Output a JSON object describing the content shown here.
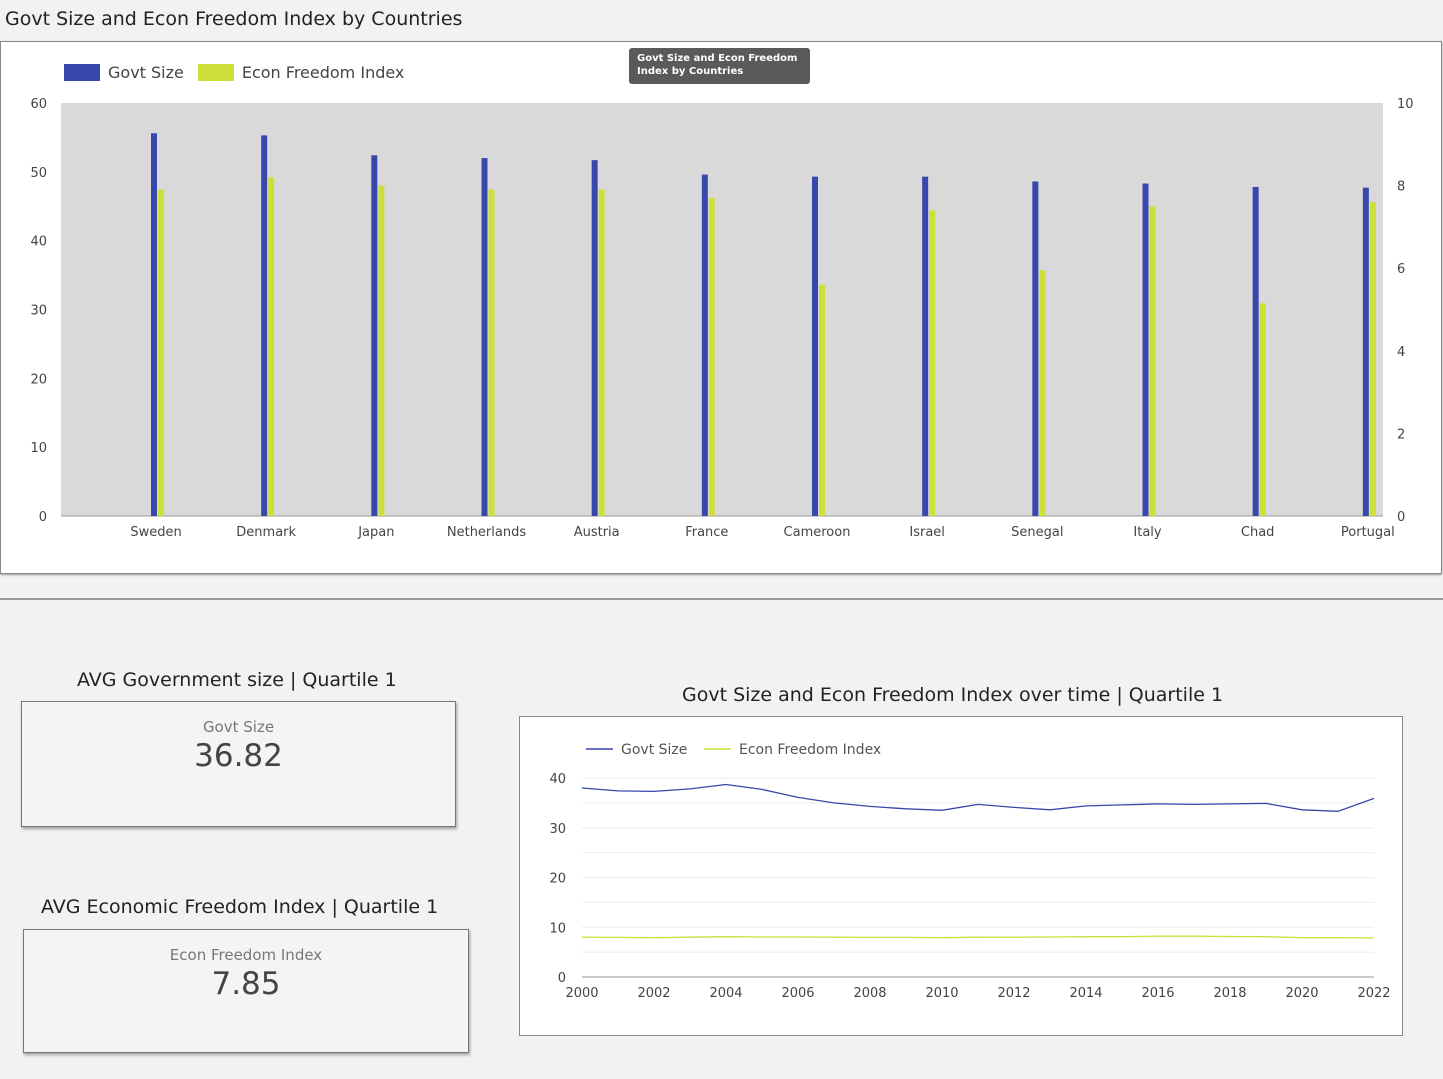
{
  "page": {
    "title": "Govt Size and Econ Freedom Index by Countries",
    "tooltip": "Govt Size and Econ Freedom Index by Countries"
  },
  "colors": {
    "govt": "#3747ac",
    "econ": "#cddf3b",
    "plot_bg": "#d9d9d9"
  },
  "bar_chart": {
    "legend": [
      "Govt Size",
      "Econ Freedom Index"
    ],
    "left_ticks": [
      "0",
      "10",
      "20",
      "30",
      "40",
      "50",
      "60"
    ],
    "right_ticks": [
      "0",
      "2",
      "4",
      "6",
      "8",
      "10"
    ]
  },
  "kpi": {
    "govt": {
      "title": "AVG Government size | Quartile 1",
      "label": "Govt Size",
      "value": "36.82"
    },
    "econ": {
      "title": "AVG Economic Freedom Index | Quartile 1",
      "label": "Econ Freedom Index",
      "value": "7.85"
    }
  },
  "line_chart": {
    "title": "Govt Size and Econ Freedom Index over time | Quartile 1",
    "legend": [
      "Govt Size",
      "Econ Freedom Index"
    ],
    "y_ticks": [
      "0",
      "10",
      "20",
      "30",
      "40"
    ],
    "x_ticks": [
      "2000",
      "2002",
      "2004",
      "2006",
      "2008",
      "2010",
      "2012",
      "2014",
      "2016",
      "2018",
      "2020",
      "2022"
    ]
  },
  "chart_data": [
    {
      "type": "bar",
      "categories": [
        "Sweden",
        "Denmark",
        "Japan",
        "Netherlands",
        "Austria",
        "France",
        "Cameroon",
        "Israel",
        "Senegal",
        "Italy",
        "Chad",
        "Portugal"
      ],
      "series": [
        {
          "name": "Govt Size",
          "axis": "left",
          "values": [
            55.6,
            55.3,
            52.4,
            52.0,
            51.7,
            49.6,
            49.3,
            49.3,
            48.6,
            48.3,
            47.8,
            47.7
          ]
        },
        {
          "name": "Econ Freedom Index",
          "axis": "right",
          "values": [
            7.9,
            8.2,
            8.0,
            7.9,
            7.9,
            7.7,
            5.6,
            7.4,
            5.95,
            7.5,
            5.15,
            7.6
          ]
        }
      ],
      "title": "Govt Size and Econ Freedom Index by Countries",
      "ylim": [
        0,
        60
      ],
      "y2lim": [
        0,
        10
      ],
      "legend": "top-left"
    },
    {
      "type": "line",
      "x": [
        2000,
        2001,
        2002,
        2003,
        2004,
        2005,
        2006,
        2007,
        2008,
        2009,
        2010,
        2011,
        2012,
        2013,
        2014,
        2015,
        2016,
        2017,
        2018,
        2019,
        2020,
        2021,
        2022
      ],
      "series": [
        {
          "name": "Govt Size",
          "values": [
            38.0,
            37.4,
            37.3,
            37.8,
            38.7,
            37.7,
            36.1,
            35.0,
            34.3,
            33.8,
            33.5,
            34.7,
            34.1,
            33.6,
            34.4,
            34.6,
            34.8,
            34.7,
            34.8,
            34.9,
            33.6,
            33.3,
            35.9
          ]
        },
        {
          "name": "Econ Freedom Index",
          "values": [
            8.0,
            7.95,
            7.9,
            8.0,
            8.1,
            8.05,
            8.05,
            8.0,
            7.95,
            7.95,
            7.9,
            8.0,
            8.0,
            8.05,
            8.1,
            8.1,
            8.2,
            8.2,
            8.15,
            8.1,
            7.9,
            7.9,
            7.85
          ]
        }
      ],
      "title": "Govt Size and Econ Freedom Index over time | Quartile 1",
      "ylim": [
        0,
        40
      ],
      "xlim": [
        2000,
        2022
      ],
      "legend": "top-left",
      "grid": true
    }
  ]
}
